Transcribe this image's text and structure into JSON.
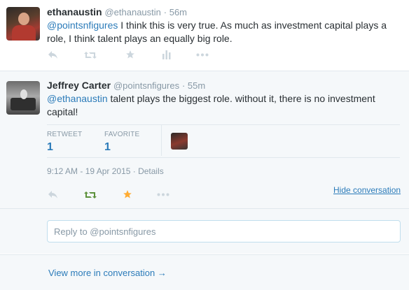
{
  "tweets": [
    {
      "name": "ethanaustin",
      "handle": "@ethanaustin",
      "time": "· 56m",
      "mention": "@pointsnfigures",
      "text": " I think this is very true.  As much as investment capital plays a role, I think talent plays an equally big role."
    },
    {
      "name": "Jeffrey Carter",
      "handle": "@pointsnfigures",
      "time": "· 55m",
      "mention": "@ethanaustin",
      "text": " talent plays the biggest role.   without it, there is no investment capital!",
      "stats": {
        "retweet_label": "RETWEET",
        "retweet_count": "1",
        "favorite_label": "FAVORITE",
        "favorite_count": "1"
      },
      "timestamp": "9:12 AM - 19 Apr 2015 · Details",
      "hide_conversation": "Hide conversation"
    }
  ],
  "icons": {
    "reply": "reply-icon",
    "retweet": "retweet-icon",
    "favorite": "star-icon",
    "analytics": "bar-chart-icon",
    "more": "more-dots-icon"
  },
  "colors": {
    "link": "#2b7bb9",
    "retweet_active": "#5c913b",
    "favorite_active": "#ffac33",
    "icon_inactive": "#ccd6dd"
  },
  "reply": {
    "placeholder": "Reply to @pointsnfigures"
  },
  "more_conversation": "View more in conversation →"
}
